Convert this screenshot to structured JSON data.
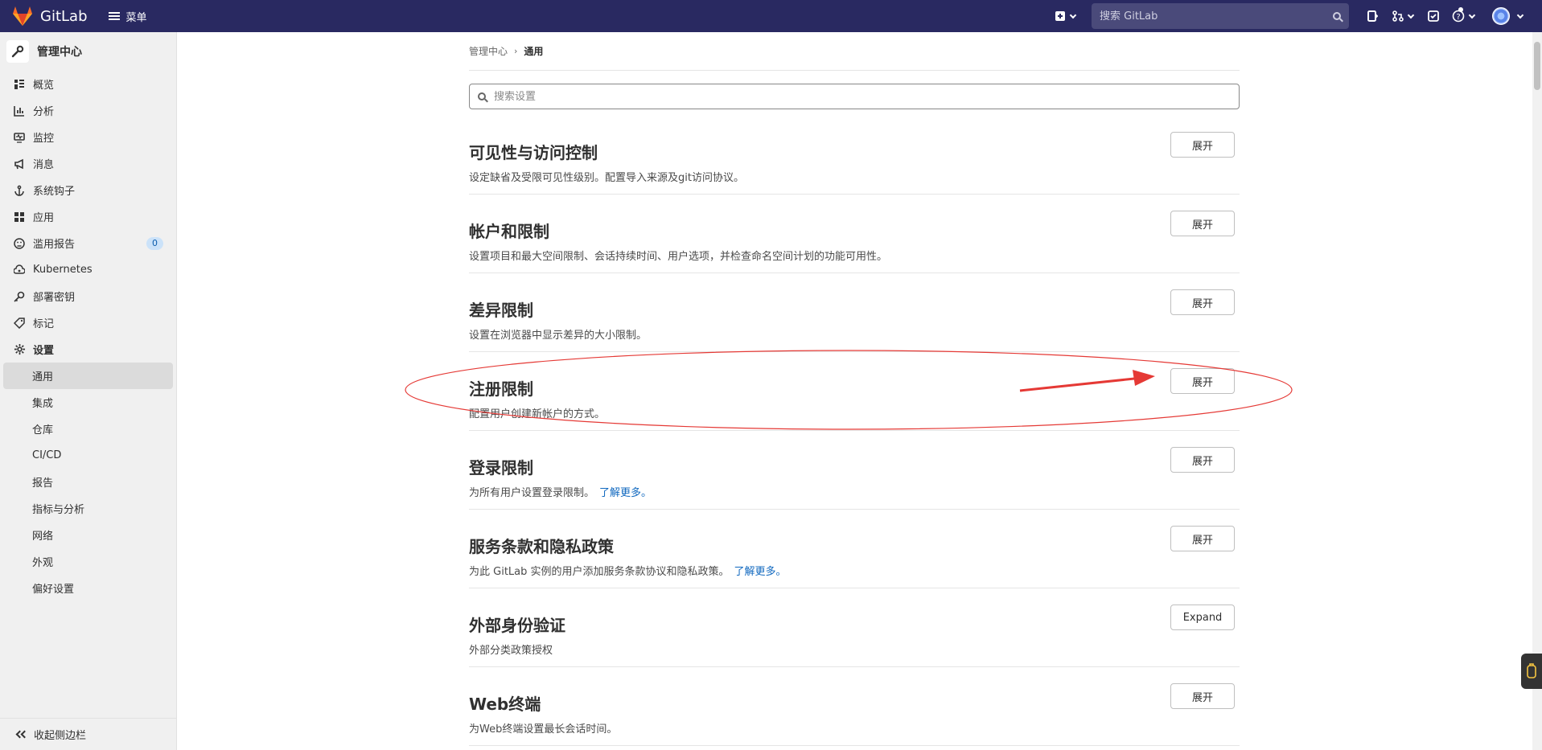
{
  "topbar": {
    "brand": "GitLab",
    "menu_label": "菜单",
    "search_placeholder": "搜索 GitLab"
  },
  "sidebar": {
    "title": "管理中心",
    "items": [
      {
        "label": "概览"
      },
      {
        "label": "分析"
      },
      {
        "label": "监控"
      },
      {
        "label": "消息"
      },
      {
        "label": "系统钩子"
      },
      {
        "label": "应用"
      },
      {
        "label": "滥用报告",
        "count": "0"
      },
      {
        "label": "Kubernetes"
      },
      {
        "label": "部署密钥"
      },
      {
        "label": "标记"
      },
      {
        "label": "设置"
      }
    ],
    "sub_items": [
      {
        "label": "通用"
      },
      {
        "label": "集成"
      },
      {
        "label": "仓库"
      },
      {
        "label": "CI/CD"
      },
      {
        "label": "报告"
      },
      {
        "label": "指标与分析"
      },
      {
        "label": "网络"
      },
      {
        "label": "外观"
      },
      {
        "label": "偏好设置"
      }
    ],
    "collapse_label": "收起侧边栏"
  },
  "breadcrumb": {
    "root": "管理中心",
    "current": "通用"
  },
  "settings_search": {
    "placeholder": "搜索设置"
  },
  "sections": [
    {
      "title": "可见性与访问控制",
      "desc": "设定缺省及受限可见性级别。配置导入来源及git访问协议。",
      "button": "展开"
    },
    {
      "title": "帐户和限制",
      "desc": "设置项目和最大空间限制、会话持续时间、用户选项，并检查命名空间计划的功能可用性。",
      "button": "展开"
    },
    {
      "title": "差异限制",
      "desc": "设置在浏览器中显示差异的大小限制。",
      "button": "展开"
    },
    {
      "title": "注册限制",
      "desc": "配置用户创建新帐户的方式。",
      "button": "展开"
    },
    {
      "title": "登录限制",
      "desc": "为所有用户设置登录限制。",
      "link": "了解更多。",
      "button": "展开"
    },
    {
      "title": "服务条款和隐私政策",
      "desc": "为此 GitLab 实例的用户添加服务条款协议和隐私政策。",
      "link": "了解更多。",
      "button": "展开"
    },
    {
      "title": "外部身份验证",
      "desc": "外部分类政策授权",
      "button": "Expand"
    },
    {
      "title": "Web终端",
      "desc": "为Web终端设置最长会话时间。",
      "button": "展开"
    }
  ],
  "colors": {
    "topbar": "#292961",
    "link": "#1068bf",
    "annotation": "#e53935"
  }
}
